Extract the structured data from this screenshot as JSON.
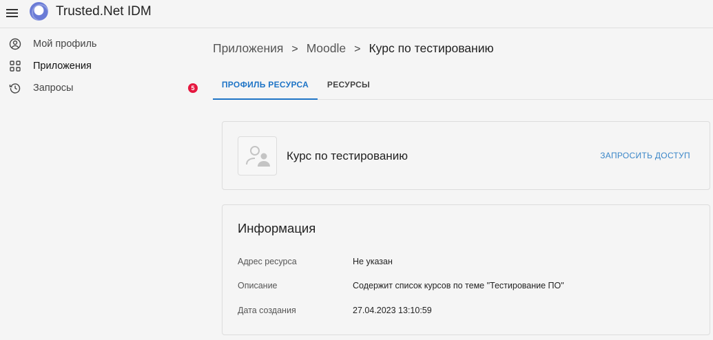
{
  "header": {
    "app_title": "Trusted.Net IDM",
    "menu_icon": "menu-icon",
    "logo_icon": "app-logo"
  },
  "sidebar": {
    "items": [
      {
        "label": "Мой профиль",
        "icon": "user-circle-icon"
      },
      {
        "label": "Приложения",
        "icon": "apps-grid-icon",
        "active": true
      },
      {
        "label": "Запросы",
        "icon": "history-icon",
        "badge": "5"
      }
    ]
  },
  "breadcrumb": {
    "items": [
      "Приложения",
      "Moodle",
      "Курс по тестированию"
    ],
    "separator": ">"
  },
  "tabs": [
    {
      "label": "ПРОФИЛЬ РЕСУРСА",
      "active": true
    },
    {
      "label": "РЕСУРСЫ",
      "active": false
    }
  ],
  "resource": {
    "name": "Курс по тестированию",
    "request_label": "ЗАПРОСИТЬ ДОСТУП",
    "avatar_icon": "users-placeholder-icon"
  },
  "info": {
    "title": "Информация",
    "rows": [
      {
        "key": "Адрес ресурса",
        "value": "Не указан"
      },
      {
        "key": "Описание",
        "value": "Содержит список курсов по теме \"Тестирование ПО\""
      },
      {
        "key": "Дата создания",
        "value": "27.04.2023 13:10:59"
      }
    ]
  },
  "colors": {
    "accent": "#1e74c6",
    "badge": "#e5173f",
    "link": "#3a86c8"
  }
}
